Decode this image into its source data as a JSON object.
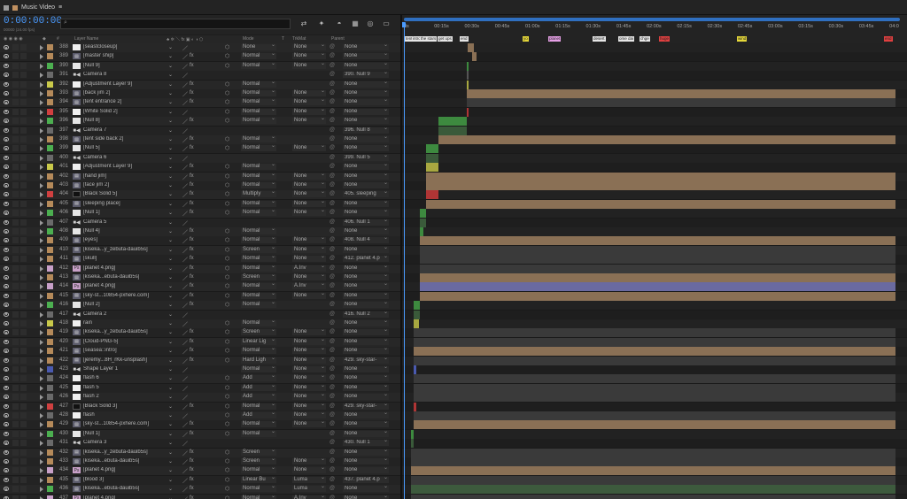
{
  "tab": {
    "title": "Music Video",
    "menu_glyph": "≡"
  },
  "toolbar": {
    "timecode": "0:00:00:00",
    "fps": "00000 (24.00 fps)",
    "search_glyph": "⌕",
    "icons": [
      "graph-editor-icon",
      "draft-3d-icon",
      "comp-flowchart-icon",
      "shy-icon",
      "motion-blur-icon",
      "frame-blend-icon"
    ]
  },
  "header": {
    "layer_name": "Layer Name",
    "hash": "#",
    "mode": "Mode",
    "t": "T",
    "trkmat": "TrkMat",
    "parent": "Parent"
  },
  "ruler": {
    "ticks": [
      "0s",
      "00:15s",
      "00:30s",
      "00:45s",
      "01:00s",
      "01:15s",
      "01:30s",
      "01:45s",
      "02:00s",
      "02:15s",
      "02:30s",
      "02:45s",
      "03:00s",
      "03:15s",
      "03:30s",
      "03:45s",
      "04:0"
    ]
  },
  "markers": [
    {
      "label": "tent",
      "color": "#e6e6e6"
    },
    {
      "label": "intro",
      "color": "#e6e6e6"
    },
    {
      "label": "the stars",
      "color": "#e6e6e6"
    },
    {
      "label": "get ups",
      "color": "#e6e6e6"
    },
    {
      "label": "end",
      "color": "#e6e6e6"
    },
    {
      "label": "yo",
      "color": "#e6d83a"
    },
    {
      "label": "planet",
      "color": "#e6a0e6"
    },
    {
      "label": "desert",
      "color": "#e6e6e6"
    },
    {
      "label": "ome dai",
      "color": "#e6e6e6"
    },
    {
      "label": "chge",
      "color": "#e6e6e6"
    },
    {
      "label": "huge",
      "color": "#e04040"
    },
    {
      "label": "wind",
      "color": "#e6d83a"
    },
    {
      "label": "end",
      "color": "#e04040"
    }
  ],
  "colors": {
    "accent": "#4a9bff",
    "timeline_nav": "#2f6fc0"
  },
  "layers": [
    {
      "num": "388",
      "label": "#b58a5a",
      "icon": "solid",
      "name": "[seastcloseup]",
      "mode": "None",
      "trk": "None",
      "parent": "None",
      "bar": {
        "s": 0.13,
        "e": 0.143,
        "c": "#8a7055"
      }
    },
    {
      "num": "389",
      "label": "#b58a5a",
      "icon": "footage",
      "name": "[master ship]",
      "mode": "Normal",
      "trk": "None",
      "parent": "None",
      "bar": {
        "s": 0.138,
        "e": 0.148,
        "c": "#8a7055"
      }
    },
    {
      "num": "390",
      "label": "#4caf50",
      "icon": "null",
      "name": "[Null 9]",
      "mode": "Normal",
      "trk": "None",
      "parent": "None",
      "bar": {
        "s": 0.128,
        "e": 0.132,
        "c": "#3d8a3f"
      }
    },
    {
      "num": "391",
      "label": "#6a6a6a",
      "icon": "cam",
      "name": "Camera 8",
      "mode": "",
      "trk": "",
      "parent": "390. Null 9",
      "bar": {
        "s": 0.128,
        "e": 0.132,
        "c": "#555"
      }
    },
    {
      "num": "392",
      "label": "#c9c94a",
      "icon": "solid",
      "name": "[Adjustment Layer 9]",
      "mode": "Normal",
      "trk": "",
      "parent": "None",
      "bar": {
        "s": 0.128,
        "e": 0.132,
        "c": "#a8a840"
      }
    },
    {
      "num": "393",
      "label": "#b58a5a",
      "icon": "footage",
      "name": "[back jim 2]",
      "mode": "Normal",
      "trk": "None",
      "parent": "None",
      "bar": {
        "s": 0.128,
        "e": 1.0,
        "c": "#8a7055"
      }
    },
    {
      "num": "394",
      "label": "#b58a5a",
      "icon": "footage",
      "name": "[tent entrance 2]",
      "mode": "Normal",
      "trk": "None",
      "parent": "None",
      "bar": {
        "s": 0.128,
        "e": 1.0,
        "c": "#3a3a3a"
      }
    },
    {
      "num": "395",
      "label": "#d04040",
      "icon": "solid",
      "name": "[White Solid 2]",
      "mode": "Normal",
      "trk": "None",
      "parent": "None",
      "bar": {
        "s": 0.128,
        "e": 0.132,
        "c": "#b03535"
      }
    },
    {
      "num": "396",
      "label": "#4caf50",
      "icon": "null",
      "name": "[Null 8]",
      "mode": "Normal",
      "trk": "None",
      "parent": "None",
      "bar": {
        "s": 0.07,
        "e": 0.128,
        "c": "#3d8a3f"
      }
    },
    {
      "num": "397",
      "label": "#6a6a6a",
      "icon": "cam",
      "name": "Camera 7",
      "mode": "",
      "trk": "",
      "parent": "396. Null 8",
      "bar": {
        "s": 0.07,
        "e": 0.128,
        "c": "#3a5a3a"
      }
    },
    {
      "num": "398",
      "label": "#b58a5a",
      "icon": "footage",
      "name": "[tent side back 2]",
      "mode": "Normal",
      "trk": "",
      "parent": "None",
      "bar": {
        "s": 0.07,
        "e": 1.0,
        "c": "#8a7055"
      }
    },
    {
      "num": "399",
      "label": "#4caf50",
      "icon": "null",
      "name": "[Null 5]",
      "mode": "Normal",
      "trk": "None",
      "parent": "None",
      "bar": {
        "s": 0.045,
        "e": 0.07,
        "c": "#3d8a3f"
      }
    },
    {
      "num": "400",
      "label": "#6a6a6a",
      "icon": "cam",
      "name": "Camera 6",
      "mode": "",
      "trk": "",
      "parent": "399. Null 5",
      "bar": {
        "s": 0.045,
        "e": 0.07,
        "c": "#3a5a3a"
      }
    },
    {
      "num": "401",
      "label": "#c9c94a",
      "icon": "solid",
      "name": "[Adjustment Layer 9]",
      "mode": "Normal",
      "trk": "",
      "parent": "None",
      "bar": {
        "s": 0.045,
        "e": 0.07,
        "c": "#a8a840"
      }
    },
    {
      "num": "402",
      "label": "#b58a5a",
      "icon": "footage",
      "name": "[hand jim]",
      "mode": "Normal",
      "trk": "None",
      "parent": "None",
      "bar": {
        "s": 0.045,
        "e": 1.0,
        "c": "#8a7055"
      }
    },
    {
      "num": "403",
      "label": "#b58a5a",
      "icon": "footage",
      "name": "[face jim 2]",
      "mode": "Normal",
      "trk": "None",
      "parent": "None",
      "bar": {
        "s": 0.045,
        "e": 1.0,
        "c": "#8a7055"
      }
    },
    {
      "num": "404",
      "label": "#d04040",
      "icon": "blk",
      "name": "[Black Solid 5]",
      "mode": "Multiply",
      "trk": "None",
      "parent": "405. sleeping",
      "bar": {
        "s": 0.045,
        "e": 0.07,
        "c": "#b03535"
      }
    },
    {
      "num": "405",
      "label": "#b58a5a",
      "icon": "footage",
      "name": "[sleeping place]",
      "mode": "Normal",
      "trk": "None",
      "parent": "None",
      "bar": {
        "s": 0.045,
        "e": 1.0,
        "c": "#8a7055"
      }
    },
    {
      "num": "406",
      "label": "#4caf50",
      "icon": "null",
      "name": "[Null 1]",
      "mode": "Normal",
      "trk": "None",
      "parent": "None",
      "bar": {
        "s": 0.032,
        "e": 0.045,
        "c": "#3d8a3f"
      }
    },
    {
      "num": "407",
      "label": "#6a6a6a",
      "icon": "cam",
      "name": "Camera 5",
      "mode": "",
      "trk": "",
      "parent": "406. Null 1",
      "bar": {
        "s": 0.032,
        "e": 0.045,
        "c": "#3a5a3a"
      }
    },
    {
      "num": "408",
      "label": "#4caf50",
      "icon": "null",
      "name": "[Null 4]",
      "mode": "Normal",
      "trk": "",
      "parent": "None",
      "bar": {
        "s": 0.032,
        "e": 0.04,
        "c": "#3d8a3f"
      }
    },
    {
      "num": "409",
      "label": "#b58a5a",
      "icon": "footage",
      "name": "[eyes]",
      "mode": "Normal",
      "trk": "None",
      "parent": "408. Null 4",
      "bar": {
        "s": 0.032,
        "e": 1.0,
        "c": "#8a7055"
      }
    },
    {
      "num": "410",
      "label": "#b58a5a",
      "icon": "footage",
      "name": "[kiseka...y_zebuta-dauib5s]",
      "mode": "Screen",
      "trk": "None",
      "parent": "None",
      "bar": {
        "s": 0.032,
        "e": 1.0,
        "c": "#3a3a3a"
      }
    },
    {
      "num": "411",
      "label": "#b58a5a",
      "icon": "footage",
      "name": "[skull]",
      "mode": "Normal",
      "trk": "None",
      "parent": "412. planet 4.p",
      "bar": {
        "s": 0.032,
        "e": 1.0,
        "c": "#3a3a3a"
      }
    },
    {
      "num": "412",
      "label": "#c8a0c8",
      "icon": "psd",
      "name": "[planet 4.png]",
      "mode": "Normal",
      "trk": "A.Inv",
      "parent": "None",
      "bar": {
        "s": 0.032,
        "e": 1.0,
        "c": "#3a3a3a"
      }
    },
    {
      "num": "413",
      "label": "#b58a5a",
      "icon": "footage",
      "name": "[kiseka...ebuta-dauib5s]",
      "mode": "Screen",
      "trk": "None",
      "parent": "None",
      "bar": {
        "s": 0.032,
        "e": 1.0,
        "c": "#8a7055"
      }
    },
    {
      "num": "414",
      "label": "#c8a0c8",
      "icon": "psd",
      "name": "[planet 4.png]",
      "mode": "Normal",
      "trk": "A.Inv",
      "parent": "None",
      "bar": {
        "s": 0.032,
        "e": 1.0,
        "c": "#6a6aa0"
      }
    },
    {
      "num": "415",
      "label": "#b58a5a",
      "icon": "footage",
      "name": "[sky-st...10854-pxhere.com]",
      "mode": "Normal",
      "trk": "None",
      "parent": "None",
      "bar": {
        "s": 0.032,
        "e": 1.0,
        "c": "#8a7055"
      }
    },
    {
      "num": "416",
      "label": "#4caf50",
      "icon": "null",
      "name": "[Null 2]",
      "mode": "Normal",
      "trk": "",
      "parent": "None",
      "bar": {
        "s": 0.02,
        "e": 0.032,
        "c": "#3d8a3f"
      }
    },
    {
      "num": "417",
      "label": "#6a6a6a",
      "icon": "cam",
      "name": "Camera 2",
      "mode": "",
      "trk": "",
      "parent": "416. Null 2",
      "bar": {
        "s": 0.02,
        "e": 0.032,
        "c": "#3a5a3a"
      }
    },
    {
      "num": "418",
      "label": "#c9c94a",
      "icon": "solid",
      "name": "rain",
      "mode": "Normal",
      "trk": "",
      "parent": "None",
      "bar": {
        "s": 0.02,
        "e": 0.03,
        "c": "#a8a840"
      }
    },
    {
      "num": "419",
      "label": "#b58a5a",
      "icon": "footage",
      "name": "[kiseka...y_zebuta-dauib5s]",
      "mode": "Screen",
      "trk": "None",
      "parent": "None",
      "bar": {
        "s": 0.02,
        "e": 1.0,
        "c": "#3a3a3a"
      }
    },
    {
      "num": "420",
      "label": "#b58a5a",
      "icon": "footage",
      "name": "[Cloud-PNG-5]",
      "mode": "Linear Lig",
      "trk": "None",
      "parent": "None",
      "bar": {
        "s": 0.02,
        "e": 1.0,
        "c": "#3a3a3a"
      }
    },
    {
      "num": "421",
      "label": "#b58a5a",
      "icon": "footage",
      "name": "[seasea::intro]",
      "mode": "Normal",
      "trk": "None",
      "parent": "None",
      "bar": {
        "s": 0.02,
        "e": 1.0,
        "c": "#8a7055"
      }
    },
    {
      "num": "422",
      "label": "#b58a5a",
      "icon": "footage",
      "name": "[jeremy...8H_rKk-unsplash]",
      "mode": "Hard Ligh",
      "trk": "None",
      "parent": "429. sky-star-",
      "bar": {
        "s": 0.02,
        "e": 1.0,
        "c": "#3a3a3a"
      }
    },
    {
      "num": "423",
      "label": "#4a5ab0",
      "icon": "cam",
      "name": "Shape Layer 1",
      "mode": "Normal",
      "trk": "None",
      "parent": "None",
      "bar": {
        "s": 0.02,
        "e": 0.026,
        "c": "#4a5ab0"
      }
    },
    {
      "num": "424",
      "label": "#6a6a6a",
      "icon": "solid",
      "name": "flash 6",
      "mode": "Add",
      "trk": "None",
      "parent": "None",
      "bar": {
        "s": 0.02,
        "e": 1.0,
        "c": "#3a3a3a"
      }
    },
    {
      "num": "425",
      "label": "#6a6a6a",
      "icon": "solid",
      "name": "flash 5",
      "mode": "Add",
      "trk": "None",
      "parent": "None",
      "bar": {
        "s": 0.02,
        "e": 1.0,
        "c": "#3a3a3a"
      }
    },
    {
      "num": "426",
      "label": "#6a6a6a",
      "icon": "solid",
      "name": "flash 2",
      "mode": "Add",
      "trk": "None",
      "parent": "None",
      "bar": {
        "s": 0.02,
        "e": 1.0,
        "c": "#3a3a3a"
      }
    },
    {
      "num": "427",
      "label": "#d04040",
      "icon": "blk",
      "name": "[Black Solid 3]",
      "mode": "Normal",
      "trk": "None",
      "parent": "429. sky-star-",
      "bar": {
        "s": 0.02,
        "e": 0.026,
        "c": "#b03535"
      }
    },
    {
      "num": "428",
      "label": "#6a6a6a",
      "icon": "solid",
      "name": "flash",
      "mode": "Add",
      "trk": "None",
      "parent": "None",
      "bar": {
        "s": 0.02,
        "e": 1.0,
        "c": "#3a3a3a"
      }
    },
    {
      "num": "429",
      "label": "#b58a5a",
      "icon": "footage",
      "name": "[sky-st...10854-pxhere.com]",
      "mode": "Normal",
      "trk": "None",
      "parent": "None",
      "bar": {
        "s": 0.02,
        "e": 1.0,
        "c": "#8a7055"
      }
    },
    {
      "num": "430",
      "label": "#4caf50",
      "icon": "null",
      "name": "[Null 1]",
      "mode": "Normal",
      "trk": "",
      "parent": "None",
      "bar": {
        "s": 0.015,
        "e": 0.02,
        "c": "#3d8a3f"
      }
    },
    {
      "num": "431",
      "label": "#6a6a6a",
      "icon": "cam",
      "name": "Camera 3",
      "mode": "",
      "trk": "",
      "parent": "430. Null 1",
      "bar": {
        "s": 0.015,
        "e": 0.02,
        "c": "#3a5a3a"
      }
    },
    {
      "num": "432",
      "label": "#b58a5a",
      "icon": "footage",
      "name": "[kiseka...y_zebuta-dauib5s]",
      "mode": "Screen",
      "trk": "",
      "parent": "None",
      "bar": {
        "s": 0.015,
        "e": 1.0,
        "c": "#3a3a3a"
      }
    },
    {
      "num": "433",
      "label": "#b58a5a",
      "icon": "footage",
      "name": "[kiseka...ebuta-dauib5s]",
      "mode": "Screen",
      "trk": "None",
      "parent": "None",
      "bar": {
        "s": 0.015,
        "e": 1.0,
        "c": "#3a3a3a"
      }
    },
    {
      "num": "434",
      "label": "#c8a0c8",
      "icon": "psd",
      "name": "[planet 4.png]",
      "mode": "Normal",
      "trk": "None",
      "parent": "None",
      "bar": {
        "s": 0.015,
        "e": 1.0,
        "c": "#8a7055"
      }
    },
    {
      "num": "435",
      "label": "#b58a5a",
      "icon": "footage",
      "name": "[blood 3]",
      "mode": "Linear Bu",
      "trk": "Luma",
      "parent": "437. planet 4.p",
      "bar": {
        "s": 0.015,
        "e": 1.0,
        "c": "#3a3a3a"
      }
    },
    {
      "num": "436",
      "label": "#4caf50",
      "icon": "footage",
      "name": "[kiseka...ebuta-dauib5s]",
      "mode": "Normal",
      "trk": "Luma",
      "parent": "None",
      "bar": {
        "s": 0.015,
        "e": 1.0,
        "c": "#3d5a3d"
      }
    },
    {
      "num": "437",
      "label": "#c8a0c8",
      "icon": "psd",
      "name": "[planet 4.png]",
      "mode": "Normal",
      "trk": "A.Inv",
      "parent": "None",
      "bar": {
        "s": 0.015,
        "e": 1.0,
        "c": "#3a3a3a"
      }
    }
  ]
}
